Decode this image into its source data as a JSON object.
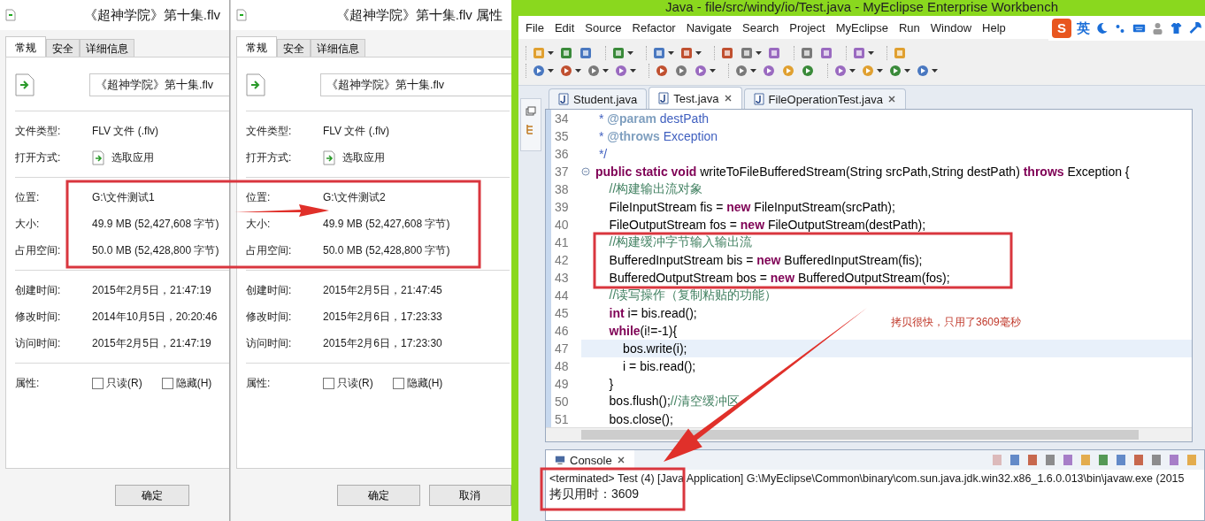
{
  "dialogs": [
    {
      "title": "《超神学院》第十集.flv",
      "tabs": [
        {
          "label": "常规",
          "selected": true
        },
        {
          "label": "安全",
          "selected": false
        },
        {
          "label": "详细信息",
          "selected": false
        }
      ],
      "file_name": "《超神学院》第十集.flv",
      "type_rows": [
        {
          "label": "文件类型:",
          "value": "FLV 文件 (.flv)"
        }
      ],
      "open_with": {
        "label": "打开方式:",
        "value": "选取应用"
      },
      "location_rows": [
        {
          "label": "位置:",
          "value": "G:\\文件测试1"
        },
        {
          "label": "大小:",
          "value": "49.9 MB (52,427,608 字节)"
        },
        {
          "label": "占用空间:",
          "value": "50.0 MB (52,428,800 字节)"
        }
      ],
      "time_rows": [
        {
          "label": "创建时间:",
          "value": "2015年2月5日，21:47:19"
        },
        {
          "label": "修改时间:",
          "value": "2014年10月5日，20:20:46"
        },
        {
          "label": "访问时间:",
          "value": "2015年2月5日，21:47:19"
        }
      ],
      "attributes": {
        "label": "属性:",
        "options": [
          {
            "label": "只读(R)",
            "checked": false
          },
          {
            "label": "隐藏(H)",
            "checked": false
          }
        ]
      },
      "buttons": [
        "确定"
      ]
    },
    {
      "title": "《超神学院》第十集.flv 属性",
      "tabs": [
        {
          "label": "常规",
          "selected": true
        },
        {
          "label": "安全",
          "selected": false
        },
        {
          "label": "详细信息",
          "selected": false
        }
      ],
      "file_name": "《超神学院》第十集.flv",
      "type_rows": [
        {
          "label": "文件类型:",
          "value": "FLV 文件 (.flv)"
        }
      ],
      "open_with": {
        "label": "打开方式:",
        "value": "选取应用"
      },
      "location_rows": [
        {
          "label": "位置:",
          "value": "G:\\文件测试2"
        },
        {
          "label": "大小:",
          "value": "49.9 MB (52,427,608 字节)"
        },
        {
          "label": "占用空间:",
          "value": "50.0 MB (52,428,800 字节)"
        }
      ],
      "time_rows": [
        {
          "label": "创建时间:",
          "value": "2015年2月5日，21:47:45"
        },
        {
          "label": "修改时间:",
          "value": "2015年2月6日，17:23:33"
        },
        {
          "label": "访问时间:",
          "value": "2015年2月6日，17:23:30"
        }
      ],
      "attributes": {
        "label": "属性:",
        "options": [
          {
            "label": "只读(R)",
            "checked": false
          },
          {
            "label": "隐藏(H)",
            "checked": false
          }
        ]
      },
      "buttons": [
        "确定",
        "取消"
      ]
    }
  ],
  "ide": {
    "title": "Java - file/src/windy/io/Test.java - MyEclipse Enterprise Workbench",
    "menu": [
      "File",
      "Edit",
      "Source",
      "Refactor",
      "Navigate",
      "Search",
      "Project",
      "MyEclipse",
      "Run",
      "Window",
      "Help"
    ],
    "ime": {
      "logo": "S",
      "mode": "英"
    },
    "editor_tabs": [
      {
        "label": "Student.java",
        "selected": false,
        "closable": false
      },
      {
        "label": "Test.java",
        "selected": true,
        "closable": true
      },
      {
        "label": "FileOperationTest.java",
        "selected": false,
        "closable": true
      }
    ],
    "code_lines": [
      {
        "num": "34",
        "current": false,
        "fold": false,
        "tokens": [
          {
            "kind": "doc",
            "text": " * "
          },
          {
            "kind": "doctag",
            "text": "@param"
          },
          {
            "kind": "doc",
            "text": " destPath"
          }
        ]
      },
      {
        "num": "35",
        "current": false,
        "fold": false,
        "tokens": [
          {
            "kind": "doc",
            "text": " * "
          },
          {
            "kind": "doctag",
            "text": "@throws"
          },
          {
            "kind": "doc",
            "text": " Exception"
          }
        ]
      },
      {
        "num": "36",
        "current": false,
        "fold": false,
        "tokens": [
          {
            "kind": "doc",
            "text": " */"
          }
        ]
      },
      {
        "num": "37",
        "current": false,
        "fold": true,
        "tokens": [
          {
            "kind": "keyword",
            "text": "public static void"
          },
          {
            "kind": "plain",
            "text": " writeToFileBufferedStream(String srcPath,String destPath) "
          },
          {
            "kind": "keyword",
            "text": "throws"
          },
          {
            "kind": "plain",
            "text": " Exception {"
          }
        ]
      },
      {
        "num": "38",
        "current": false,
        "fold": false,
        "tokens": [
          {
            "kind": "comment",
            "text": "    //构建输出流对象"
          }
        ]
      },
      {
        "num": "39",
        "current": false,
        "fold": false,
        "tokens": [
          {
            "kind": "plain",
            "text": "    FileInputStream fis = "
          },
          {
            "kind": "keyword",
            "text": "new"
          },
          {
            "kind": "plain",
            "text": " FileInputStream(srcPath);"
          }
        ]
      },
      {
        "num": "40",
        "current": false,
        "fold": false,
        "tokens": [
          {
            "kind": "plain",
            "text": "    FileOutputStream fos = "
          },
          {
            "kind": "keyword",
            "text": "new"
          },
          {
            "kind": "plain",
            "text": " FileOutputStream(destPath);"
          }
        ]
      },
      {
        "num": "41",
        "current": false,
        "fold": false,
        "tokens": [
          {
            "kind": "comment",
            "text": "    //构建缓冲字节输入输出流"
          }
        ]
      },
      {
        "num": "42",
        "current": false,
        "fold": false,
        "tokens": [
          {
            "kind": "plain",
            "text": "    BufferedInputStream bis = "
          },
          {
            "kind": "keyword",
            "text": "new"
          },
          {
            "kind": "plain",
            "text": " BufferedInputStream(fis);"
          }
        ]
      },
      {
        "num": "43",
        "current": false,
        "fold": false,
        "tokens": [
          {
            "kind": "plain",
            "text": "    BufferedOutputStream bos = "
          },
          {
            "kind": "keyword",
            "text": "new"
          },
          {
            "kind": "plain",
            "text": " BufferedOutputStream(fos);"
          }
        ]
      },
      {
        "num": "44",
        "current": false,
        "fold": false,
        "tokens": [
          {
            "kind": "comment",
            "text": "    //读写操作（复制粘贴的功能）"
          }
        ]
      },
      {
        "num": "45",
        "current": false,
        "fold": false,
        "tokens": [
          {
            "kind": "keyword",
            "text": "    int"
          },
          {
            "kind": "plain",
            "text": " i= bis.read();"
          }
        ]
      },
      {
        "num": "46",
        "current": false,
        "fold": false,
        "tokens": [
          {
            "kind": "keyword",
            "text": "    while"
          },
          {
            "kind": "plain",
            "text": "(i!=-1){"
          }
        ]
      },
      {
        "num": "47",
        "current": true,
        "fold": false,
        "tokens": [
          {
            "kind": "plain",
            "text": "        bos.write(i);"
          }
        ]
      },
      {
        "num": "48",
        "current": false,
        "fold": false,
        "tokens": [
          {
            "kind": "plain",
            "text": "        i = bis.read();"
          }
        ]
      },
      {
        "num": "49",
        "current": false,
        "fold": false,
        "tokens": [
          {
            "kind": "plain",
            "text": "    }"
          }
        ]
      },
      {
        "num": "50",
        "current": false,
        "fold": false,
        "tokens": [
          {
            "kind": "plain",
            "text": "    bos.flush();"
          },
          {
            "kind": "comment",
            "text": "//清空缓冲区"
          }
        ]
      },
      {
        "num": "51",
        "current": false,
        "fold": false,
        "tokens": [
          {
            "kind": "plain",
            "text": "    bos.close();"
          }
        ]
      }
    ],
    "console": {
      "tab": "Console",
      "lines": [
        "<terminated> Test (4) [Java Application] G:\\MyEclipse\\Common\\binary\\com.sun.java.jdk.win32.x86_1.6.0.013\\bin\\javaw.exe (2015",
        "拷贝用时：3609"
      ]
    }
  },
  "annotation": {
    "note": "拷贝很快，只用了3609毫秒"
  }
}
